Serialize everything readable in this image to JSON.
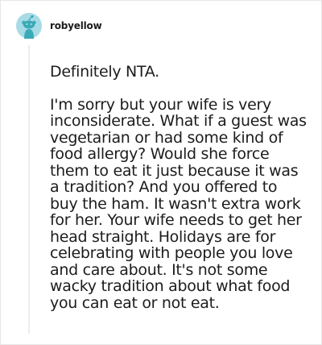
{
  "comment": {
    "username": "robyellow",
    "paragraphs": [
      "Definitely NTA.",
      "I'm sorry but your wife is very inconsiderate. What if a guest was vegetarian or had some kind of food allergy? Would she force them to eat it just because it was a tradition? And you offered to buy the ham. It wasn't extra work for her. Your wife needs to get her head straight. Holidays are for celebrating with people you love and care about. It's not some wacky tradition about what food you can eat or not eat."
    ]
  },
  "colors": {
    "avatar_bg": "#a7dbe6",
    "avatar_fg": "#3aaab8",
    "text": "#1c1c1c"
  }
}
